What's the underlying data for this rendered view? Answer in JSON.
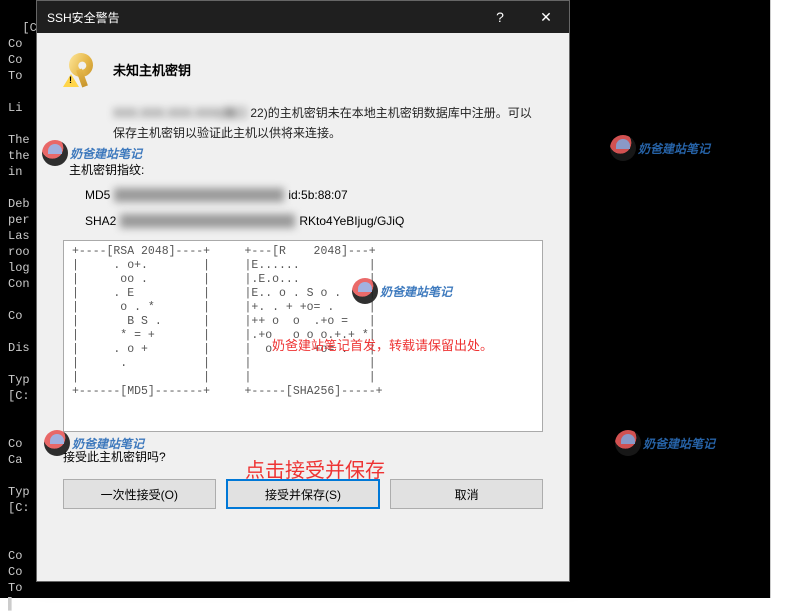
{
  "terminal_lines": [
    "[C:",
    "Co",
    "Co",
    "To",
    "",
    "Li",
    "",
    "The",
    "the",
    "in",
    "",
    "Deb",
    "per",
    "Las",
    "roo",
    "log",
    "Con",
    "",
    "Co",
    "",
    "Dis",
    "",
    "Typ",
    "[C:",
    "",
    "",
    "Co",
    "Ca",
    "",
    "Typ",
    "[C:",
    "",
    "",
    "Co",
    "Co",
    "To",
    "▌"
  ],
  "dialog": {
    "title": "SSH安全警告",
    "help_glyph": "?",
    "close_glyph": "✕",
    "heading": "未知主机密钥",
    "desc_prefix_blur": "XXX.XXX.XXX.XXX(端口",
    "desc_port": " 22)",
    "desc_rest": "的主机密钥未在本地主机密钥数据库中注册。可以保存主机密钥以验证此主机以供将来连接。",
    "fp_label": "主机密钥指纹:",
    "md5_label": "MD5",
    "md5_blur": "xx:xx:xx:xx:xx:xx:xx:xx:xx:xx:xx",
    "md5_tail": "id:5b:88:07",
    "sha_label": "SHA2",
    "sha_blur": "xxxxxxxxxxxxxxxxxxxxxxxxxxxxxxxx",
    "sha_tail": "RKto4YeBIjug/GJiQ",
    "ascii_art": "+----[RSA 2048]----+     +---[R    2048]---+\n|     . o+.        |     |E......          |\n|      oo .        |     |.E.o...          |\n|     . E          |     |E.. o . S o .    |\n|      o . *       |     |+. . + +o= .     |\n|       B S .      |     |++ o  o  .+o =   |\n|      * = +       |     |.+o   o o o.+.+ *|\n|     . o +        |     |  o      +o= .   |\n|      .           |     |                 |\n|                  |     |                 |\n+------[MD5]-------+     +-----[SHA256]-----+",
    "prompt_question": "接受此主机密钥吗?",
    "btn_once": "一次性接受(O)",
    "btn_accept": "接受并保存(S)",
    "btn_cancel": "取消"
  },
  "annotations": {
    "wm_text": "奶爸建站笔记",
    "red_line1": "奶爸建站笔记首发，转载请保留出处。",
    "red_line2": "点击接受并保存"
  }
}
